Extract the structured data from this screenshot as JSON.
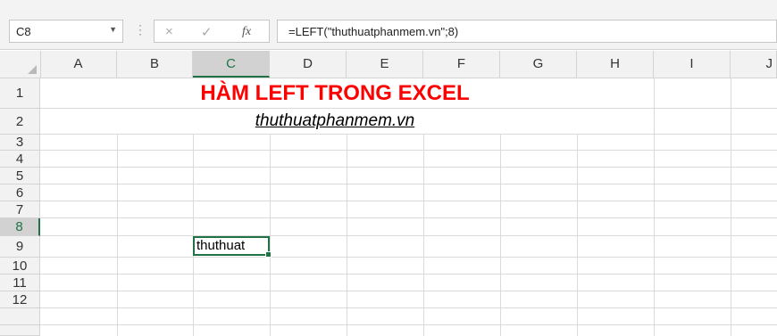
{
  "formula_bar": {
    "name_box": "C8",
    "cancel_icon": "×",
    "enter_icon": "✓",
    "fx_label": "fx",
    "formula": "=LEFT(\"thuthuatphanmem.vn\";8)"
  },
  "columns": [
    "A",
    "B",
    "C",
    "D",
    "E",
    "F",
    "G",
    "H",
    "I",
    "J"
  ],
  "rows": [
    "1",
    "2",
    "3",
    "4",
    "5",
    "6",
    "7",
    "8",
    "9",
    "10",
    "11",
    "12"
  ],
  "selected_cell": "C8",
  "cells": {
    "title": "HÀM LEFT TRONG EXCEL",
    "subtitle": "thuthuatphanmem.vn",
    "c8": "thuthuat"
  },
  "colors": {
    "title": "#ff0000",
    "accent": "#217346"
  }
}
